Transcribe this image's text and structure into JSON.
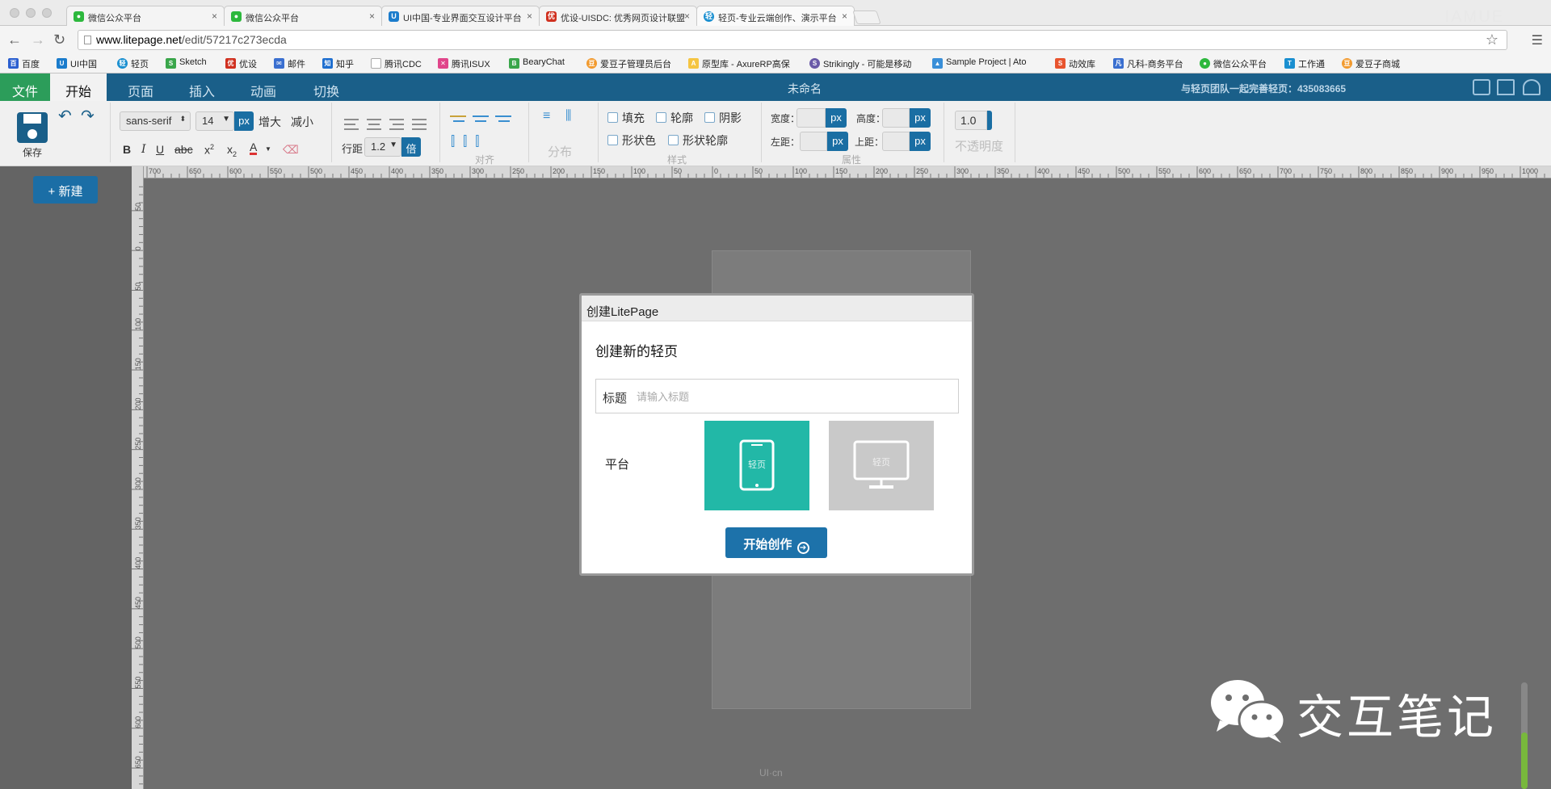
{
  "browser": {
    "tabs": [
      {
        "label": "微信公众平台",
        "color": "#2db83d"
      },
      {
        "label": "微信公众平台",
        "color": "#2db83d"
      },
      {
        "label": "UI中国-专业界面交互设计平台",
        "color": "#1b7ccc"
      },
      {
        "label": "优设-UISDC: 优秀网页设计联盟",
        "color": "#d0301f"
      },
      {
        "label": "轻页-专业云端创作、演示平台",
        "color": "#1a8fd0"
      }
    ],
    "corner_text": "IAMUE",
    "url_host": "www.litepage.net",
    "url_path": "/edit/57217c273ecda",
    "bookmarks": [
      "百度",
      "UI中国",
      "轻页",
      "Sketch",
      "优设",
      "邮件",
      "知乎",
      "腾讯CDC",
      "腾讯ISUX",
      "BearyChat",
      "爱豆子管理员后台",
      "原型库 - AxureRP高保",
      "Strikingly - 可能是移动",
      "Sample Project | Ato",
      "动效库",
      "凡科-商务平台",
      "微信公众平台",
      "工作通",
      "爱豆子商城"
    ]
  },
  "app": {
    "menu": {
      "file": "文件",
      "start": "开始",
      "page": "页面",
      "insert": "插入",
      "animation": "动画",
      "switch": "切换"
    },
    "doc_title": "未命名",
    "promo": "与轻页团队一起完善轻页：435083665"
  },
  "toolbar": {
    "save": "保存",
    "font_family": "sans-serif",
    "font_size": "14",
    "unit_px": "px",
    "increase": "增大",
    "decrease": "减小",
    "line_height_label": "行距",
    "line_height": "1.2",
    "line_unit": "倍",
    "align_label": "对齐",
    "distribute_label": "分布",
    "fill": "填充",
    "outline": "轮廓",
    "shadow": "阴影",
    "shape_color": "形状色",
    "shape_outline": "形状轮廓",
    "style_label": "样式",
    "width_label": "宽度：",
    "height_label": "高度：",
    "left_label": "左距：",
    "top_label": "上距：",
    "attr_label": "属性",
    "opacity_value": "1.0",
    "opacity_label": "不透明度"
  },
  "sidebar": {
    "new_button": "+ 新建"
  },
  "rulers": {
    "h_ticks": [
      "700",
      "650",
      "600",
      "550",
      "500",
      "450",
      "400",
      "350",
      "300",
      "250",
      "200",
      "150",
      "100",
      "50",
      "0",
      "50",
      "100",
      "150",
      "200",
      "250",
      "300",
      "350",
      "400",
      "450",
      "500",
      "550",
      "600",
      "650",
      "700",
      "750",
      "800",
      "850",
      "900",
      "950",
      "1000"
    ],
    "v_ticks": [
      "50",
      "0",
      "50",
      "100",
      "150",
      "200",
      "250",
      "300",
      "350",
      "400",
      "450",
      "500",
      "550",
      "600",
      "650"
    ]
  },
  "modal": {
    "header": "创建LitePage",
    "subtitle": "创建新的轻页",
    "title_label": "标题",
    "title_placeholder": "请输入标题",
    "title_value": "",
    "platform_label": "平台",
    "mobile_label": "轻页",
    "pc_label": "轻页",
    "start_button": "开始创作"
  },
  "watermark": {
    "text": "交互笔记",
    "site": "UI·cn"
  },
  "colors": {
    "accent": "#1a5f89",
    "teal": "#22b8a7",
    "green_tab": "#2c9d5a"
  }
}
